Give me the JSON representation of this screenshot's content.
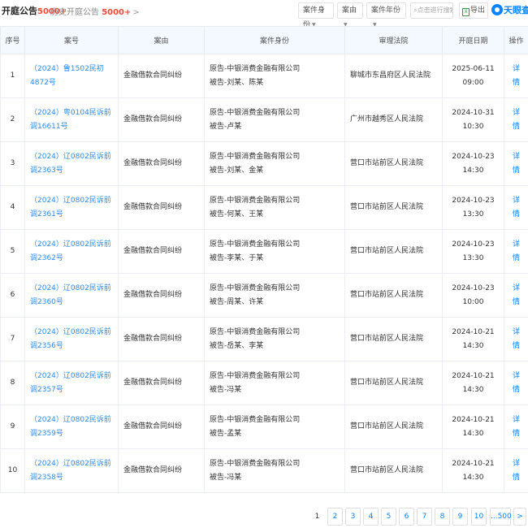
{
  "header": {
    "title": "开庭公告",
    "count": "5000+",
    "history_label": "历史开庭公告",
    "history_count": "5000+",
    "history_chevron": ">",
    "filters": [
      "案件身份",
      "案由",
      "案件年份"
    ],
    "search_placeholder": "点击进行搜索",
    "export_label": "导出",
    "export_icon": "xls-icon",
    "logo_text": "天眼查"
  },
  "table": {
    "columns": [
      "序号",
      "案号",
      "案由",
      "案件身份",
      "审理法院",
      "开庭日期",
      "操作"
    ],
    "rows": [
      {
        "no": "1",
        "case_no": "（2024）鲁1502民初4872号",
        "cause": "金融借款合同纠纷",
        "plaintiff": "原告-中银消费金融有限公司",
        "defendant": "被告-刘某、陈某",
        "court": "聊城市东昌府区人民法院",
        "date": "2025-06-11 09:00",
        "action": "详情"
      },
      {
        "no": "2",
        "case_no": "（2024）粤0104民诉前调16611号",
        "cause": "金融借款合同纠纷",
        "plaintiff": "原告-中银消费金融有限公司",
        "defendant": "被告-卢某",
        "court": "广州市越秀区人民法院",
        "date": "2024-10-31 10:30",
        "action": "详情"
      },
      {
        "no": "3",
        "case_no": "（2024）辽0802民诉前调2363号",
        "cause": "金融借款合同纠纷",
        "plaintiff": "原告-中银消费金融有限公司",
        "defendant": "被告-刘某、金某",
        "court": "营口市站前区人民法院",
        "date": "2024-10-23 14:30",
        "action": "详情"
      },
      {
        "no": "4",
        "case_no": "（2024）辽0802民诉前调2361号",
        "cause": "金融借款合同纠纷",
        "plaintiff": "原告-中银消费金融有限公司",
        "defendant": "被告-何某、王某",
        "court": "营口市站前区人民法院",
        "date": "2024-10-23 13:30",
        "action": "详情"
      },
      {
        "no": "5",
        "case_no": "（2024）辽0802民诉前调2362号",
        "cause": "金融借款合同纠纷",
        "plaintiff": "原告-中银消费金融有限公司",
        "defendant": "被告-李某、于某",
        "court": "营口市站前区人民法院",
        "date": "2024-10-23 13:30",
        "action": "详情"
      },
      {
        "no": "6",
        "case_no": "（2024）辽0802民诉前调2360号",
        "cause": "金融借款合同纠纷",
        "plaintiff": "原告-中银消费金融有限公司",
        "defendant": "被告-周某、许某",
        "court": "营口市站前区人民法院",
        "date": "2024-10-23 10:00",
        "action": "详情"
      },
      {
        "no": "7",
        "case_no": "（2024）辽0802民诉前调2356号",
        "cause": "金融借款合同纠纷",
        "plaintiff": "原告-中银消费金融有限公司",
        "defendant": "被告-岳某、李某",
        "court": "营口市站前区人民法院",
        "date": "2024-10-21 14:30",
        "action": "详情"
      },
      {
        "no": "8",
        "case_no": "（2024）辽0802民诉前调2357号",
        "cause": "金融借款合同纠纷",
        "plaintiff": "原告-中银消费金融有限公司",
        "defendant": "被告-冯某",
        "court": "营口市站前区人民法院",
        "date": "2024-10-21 14:30",
        "action": "详情"
      },
      {
        "no": "9",
        "case_no": "（2024）辽0802民诉前调2359号",
        "cause": "金融借款合同纠纷",
        "plaintiff": "原告-中银消费金融有限公司",
        "defendant": "被告-孟某",
        "court": "营口市站前区人民法院",
        "date": "2024-10-21 14:30",
        "action": "详情"
      },
      {
        "no": "10",
        "case_no": "（2024）辽0802民诉前调2358号",
        "cause": "金融借款合同纠纷",
        "plaintiff": "原告-中银消费金融有限公司",
        "defendant": "被告-冯某",
        "court": "营口市站前区人民法院",
        "date": "2024-10-21 14:30",
        "action": "详情"
      }
    ]
  },
  "pagination": {
    "pages": [
      "1",
      "2",
      "3",
      "4",
      "5",
      "6",
      "7",
      "8",
      "9",
      "10"
    ],
    "current": "1",
    "ellipsis": "...500",
    "next": ">"
  },
  "colors": {
    "accent": "#0a84ff",
    "count": "#f04a3a",
    "header_bg": "#f4f8ff"
  }
}
